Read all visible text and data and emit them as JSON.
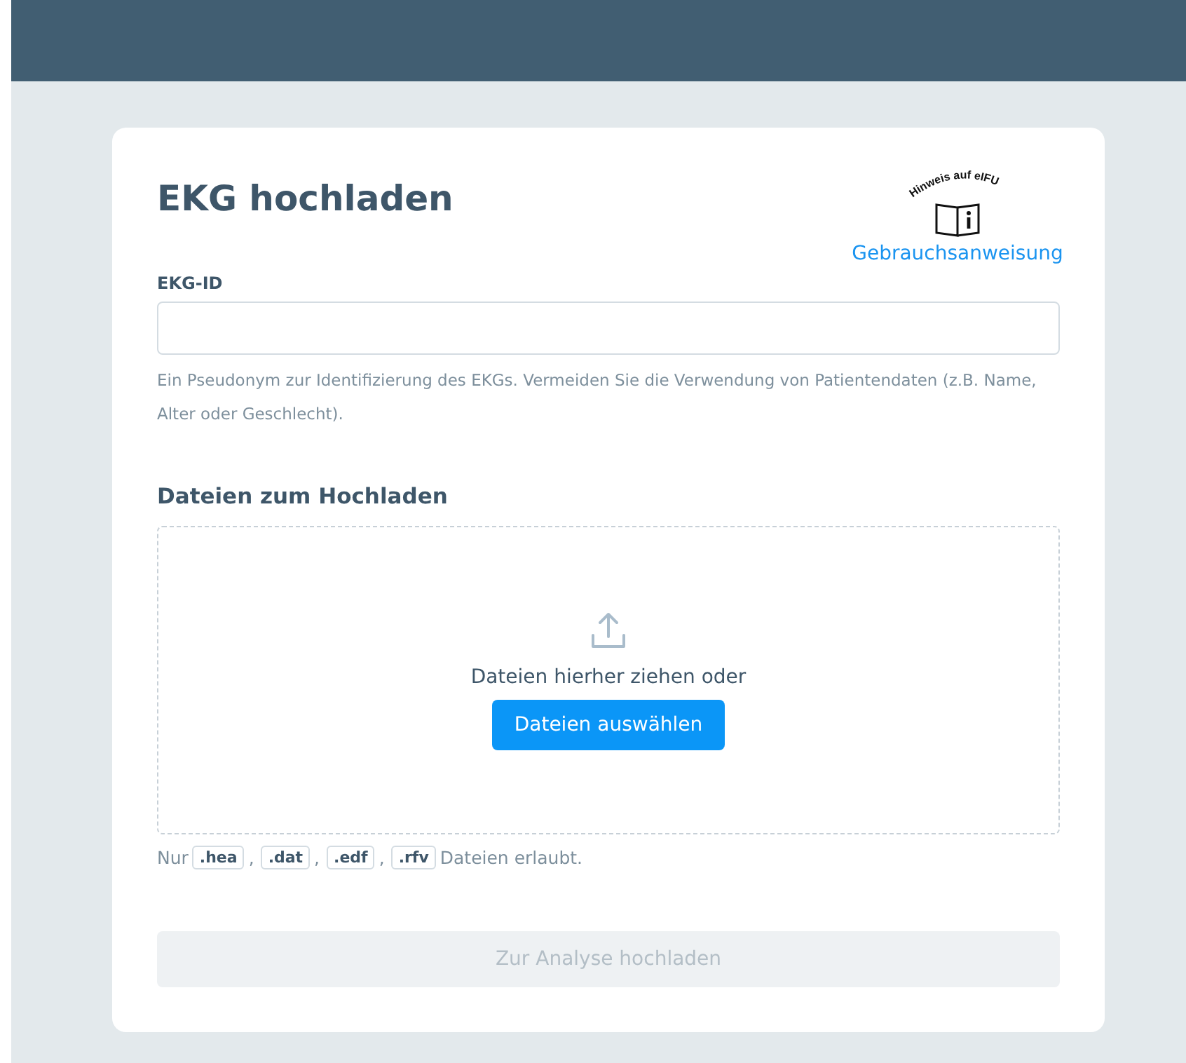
{
  "title": "EKG hochladen",
  "ifu": {
    "caption": "Hinweis auf eIFU",
    "link": "Gebrauchsanweisung"
  },
  "id_field": {
    "label": "EKG-ID",
    "help": "Ein Pseudonym zur Identifizierung des EKGs. Vermeiden Sie die Verwendung von Patientendaten (z.B. Name, Alter oder Geschlecht)."
  },
  "upload": {
    "heading": "Dateien zum Hochladen",
    "drop_text": "Dateien hierher ziehen oder",
    "choose_button": "Dateien auswählen"
  },
  "allowed": {
    "prefix": "Nur",
    "extensions": [
      ".hea",
      ".dat",
      ".edf",
      ".rfv"
    ],
    "separator": ",",
    "suffix": "Dateien erlaubt."
  },
  "submit": {
    "label": "Zur Analyse hochladen",
    "disabled": true
  }
}
